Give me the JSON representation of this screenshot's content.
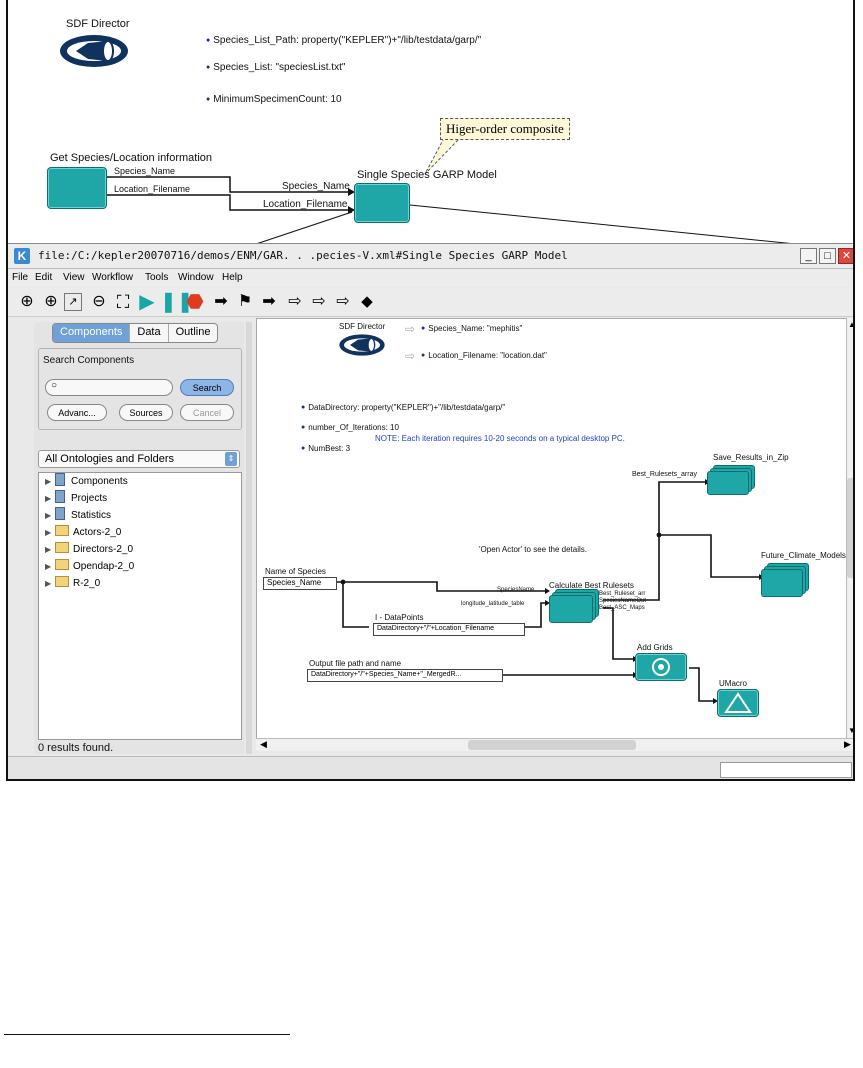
{
  "top": {
    "director_label": "SDF Director",
    "params": [
      "Species_List_Path: property(\"KEPLER\")+\"/lib/testdata/garp/\"",
      "Species_List: \"speciesList.txt\"",
      "MinimumSpecimenCount: 10"
    ],
    "callout": "Higer-order composite",
    "actor1_title": "Get Species/Location information",
    "actor1_port1": "Species_Name",
    "actor1_port2": "Location_Filename",
    "link_label1": "Species_Name",
    "link_label2": "Location_Filename",
    "actor2_title": "Single Species GARP Model"
  },
  "window": {
    "title": "file:/C:/kepler20070716/demos/ENM/GAR. . .pecies-V.xml#Single Species GARP Model",
    "menu": [
      "File",
      "Edit",
      "View",
      "Workflow",
      "Tools",
      "Window",
      "Help"
    ],
    "tabs": [
      "Components",
      "Data",
      "Outline"
    ],
    "search_label": "Search Components",
    "search_input": "",
    "search_button": "Search",
    "advanced_button": "Advanc...",
    "sources_button": "Sources",
    "cancel_button": "Cancel",
    "ontology_select": "All Ontologies and Folders",
    "tree_items": [
      "Components",
      "Projects",
      "Statistics",
      "Actors-2_0",
      "Directors-2_0",
      "Opendap-2_0",
      "R-2_0"
    ],
    "status_results": "0 results found."
  },
  "canvas": {
    "director_label": "SDF Director",
    "species_name_param": "Species_Name: \"mephitis\"",
    "location_param": "Location_Filename: \"location.dat\"",
    "datadir_param": "DataDirectory: property(\"KEPLER\")+\"/lib/testdata/garp/\"",
    "iterations_param": "number_Of_Iterations: 10",
    "note": "NOTE: Each iteration requires 10-20 seconds on a typical desktop PC.",
    "numbest_param": "NumBest: 3",
    "open_actor_hint": "'Open Actor' to see the details.",
    "save_results": "Save_Results_in_Zip",
    "future_climate": "Future_Climate_Models",
    "best_rulesets_array": "Best_Rulesets_array",
    "name_of_species": "Name of Species",
    "species_name_box": "Species_Name",
    "calc_best": "Calculate Best Rulesets",
    "species_name_port": "SpeciesName",
    "long_lat_port": "longitude_latitude_table",
    "best_ruleset_port": "Best_Ruleset_arr",
    "species_name_out_port": "SpeciesNameOut",
    "best_asc_port": "Best_ASC_Maps",
    "datapoints_title": "I - DataPoints",
    "datapoints_expr": "DataDirectory+\"/\"+Location_Filename",
    "output_path_title": "Output file path and name",
    "output_expr": "DataDirectory+\"/\"+Species_Name+\"_MergedR...",
    "add_grids": "Add Grids",
    "umacro": "UMacro"
  }
}
